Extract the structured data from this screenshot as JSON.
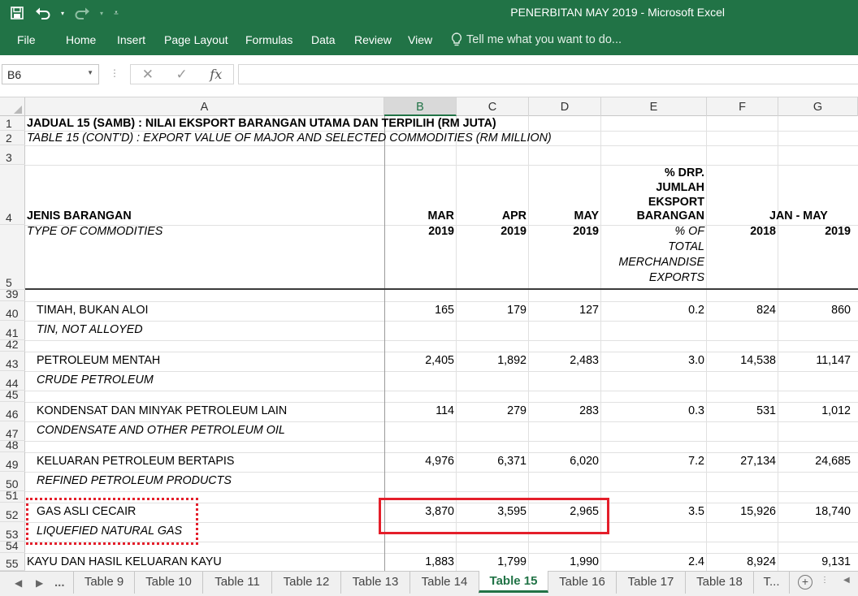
{
  "window": {
    "title": "PENERBITAN MAY 2019 - Microsoft Excel"
  },
  "qat": {
    "save_icon": "save-icon",
    "undo_icon": "undo-icon",
    "redo_icon": "redo-icon"
  },
  "ribbon": {
    "tabs": [
      "File",
      "Home",
      "Insert",
      "Page Layout",
      "Formulas",
      "Data",
      "Review",
      "View"
    ],
    "tell_me": "Tell me what you want to do..."
  },
  "formula_bar": {
    "name_box": "B6",
    "formula": "",
    "fx": "fx"
  },
  "columns": [
    "A",
    "B",
    "C",
    "D",
    "E",
    "F",
    "G"
  ],
  "selected_column": "B",
  "rows": {
    "r1": "1",
    "r2": "2",
    "r3": "3",
    "r4": "4",
    "r5": "5",
    "r39": "39",
    "r40": "40",
    "r41": "41",
    "r42": "42",
    "r43": "43",
    "r44": "44",
    "r45": "45",
    "r46": "46",
    "r47": "47",
    "r48": "48",
    "r49": "49",
    "r50": "50",
    "r51": "51",
    "r52": "52",
    "r53": "53",
    "r54": "54",
    "r55": "55"
  },
  "header": {
    "title_my": "JADUAL 15 (SAMB) : NILAI EKSPORT BARANGAN UTAMA DAN TERPILIH (RM JUTA)",
    "title_en": "TABLE 15 (CONT'D) : EXPORT VALUE OF MAJOR AND SELECTED COMMODITIES (RM MILLION)",
    "col_a_my": "JENIS BARANGAN",
    "col_a_en": "TYPE OF COMMODITIES",
    "mar": "MAR",
    "apr": "APR",
    "may": "MAY",
    "year_2019": "2019",
    "year_2018": "2018",
    "pct_my_1": "% DRP.",
    "pct_my_2": "JUMLAH",
    "pct_my_3": "EKSPORT",
    "pct_my_4": "BARANGAN",
    "pct_en_1": "% OF",
    "pct_en_2": "TOTAL",
    "pct_en_3": "MERCHANDISE",
    "pct_en_4": "EXPORTS",
    "jan_may": "JAN - MAY"
  },
  "items": [
    {
      "my": "TIMAH, BUKAN ALOI",
      "en": "TIN, NOT ALLOYED",
      "mar": "165",
      "apr": "179",
      "may": "127",
      "pct": "0.2",
      "y2018": "824",
      "y2019": "860"
    },
    {
      "my": "PETROLEUM MENTAH",
      "en": "CRUDE PETROLEUM",
      "mar": "2,405",
      "apr": "1,892",
      "may": "2,483",
      "pct": "3.0",
      "y2018": "14,538",
      "y2019": "11,147"
    },
    {
      "my": "KONDENSAT DAN MINYAK PETROLEUM LAIN",
      "en": "CONDENSATE AND OTHER PETROLEUM OIL",
      "mar": "114",
      "apr": "279",
      "may": "283",
      "pct": "0.3",
      "y2018": "531",
      "y2019": "1,012"
    },
    {
      "my": "KELUARAN PETROLEUM BERTAPIS",
      "en": "REFINED PETROLEUM PRODUCTS",
      "mar": "4,976",
      "apr": "6,371",
      "may": "6,020",
      "pct": "7.2",
      "y2018": "27,134",
      "y2019": "24,685"
    },
    {
      "my": "GAS ASLI CECAIR",
      "en": "LIQUEFIED NATURAL GAS",
      "mar": "3,870",
      "apr": "3,595",
      "may": "2,965",
      "pct": "3.5",
      "y2018": "15,926",
      "y2019": "18,740"
    },
    {
      "my": "KAYU DAN HASIL KELUARAN KAYU",
      "en": "",
      "mar": "1,883",
      "apr": "1,799",
      "may": "1,990",
      "pct": "2.4",
      "y2018": "8,924",
      "y2019": "9,131"
    }
  ],
  "sheet_tabs": [
    "Table 9",
    "Table 10",
    "Table 11",
    "Table 12",
    "Table 13",
    "Table 14",
    "Table 15",
    "Table 16",
    "Table 17",
    "Table 18",
    "T..."
  ],
  "active_sheet": "Table 15",
  "nav": {
    "ellipsis": "..."
  },
  "colors": {
    "excel_green": "#217346",
    "highlight_red": "#e41e2a"
  }
}
